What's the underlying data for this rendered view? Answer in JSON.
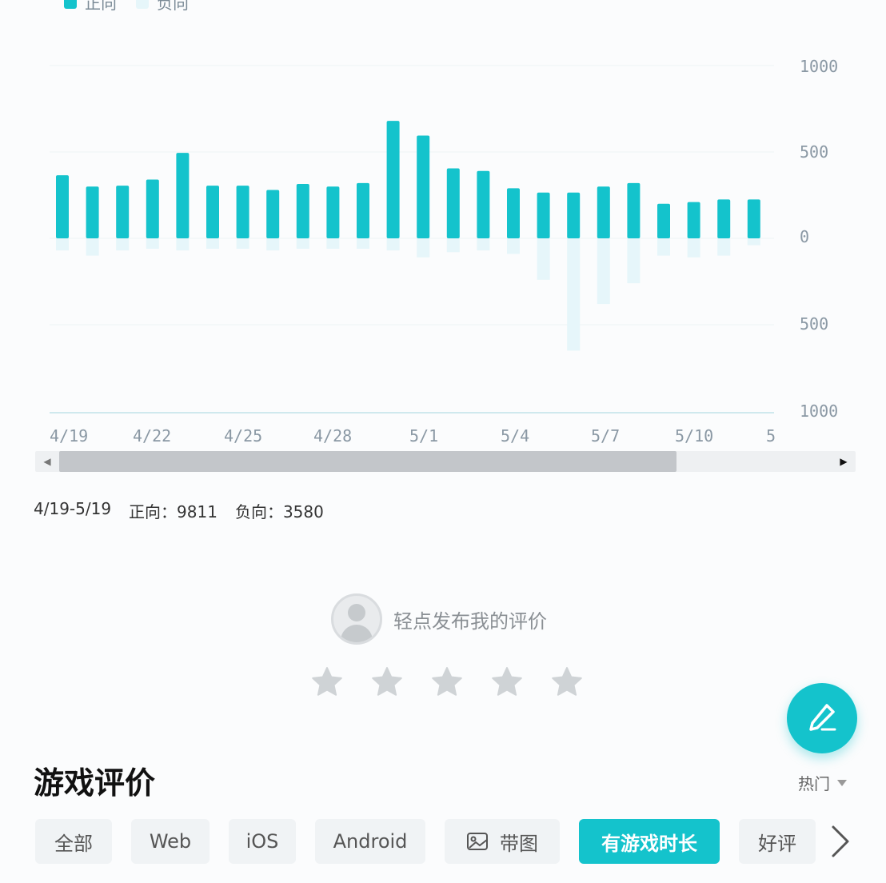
{
  "legend": {
    "positive_label": "正向",
    "negative_label": "负向",
    "positive_color": "#14c3cc",
    "negative_color": "#e6f6fa"
  },
  "chart_data": {
    "type": "bar",
    "x_tick_labels": [
      "4/19",
      "4/22",
      "4/25",
      "4/28",
      "5/1",
      "5/4",
      "5/7",
      "5/10",
      "5"
    ],
    "y_tick_labels": [
      "1000",
      "500",
      "0",
      "500",
      "1000"
    ],
    "ylim": [
      -1000,
      1000
    ],
    "categories": [
      "4/19",
      "4/20",
      "4/21",
      "4/22",
      "4/23",
      "4/24",
      "4/25",
      "4/26",
      "4/27",
      "4/28",
      "4/29",
      "4/30",
      "5/1",
      "5/2",
      "5/3",
      "5/4",
      "5/5",
      "5/6",
      "5/7",
      "5/8",
      "5/9",
      "5/10",
      "5/11",
      "5/12"
    ],
    "series": [
      {
        "name": "正向",
        "values": [
          365,
          300,
          305,
          340,
          495,
          305,
          305,
          280,
          315,
          300,
          320,
          680,
          595,
          405,
          390,
          290,
          265,
          265,
          300,
          320,
          200,
          210,
          225,
          225
        ]
      },
      {
        "name": "负向",
        "values": [
          -70,
          -100,
          -70,
          -60,
          -70,
          -60,
          -60,
          -70,
          -60,
          -60,
          -60,
          -70,
          -110,
          -80,
          -70,
          -90,
          -240,
          -650,
          -380,
          -260,
          -100,
          -110,
          -100,
          -40
        ]
      }
    ],
    "grid": true
  },
  "summary": {
    "range": "4/19-5/19",
    "positive": "正向：9811",
    "negative": "负向：3580"
  },
  "review_prompt": "轻点发布我的评价",
  "star_count": 5,
  "section_title": "游戏评价",
  "sort_label": "热门",
  "filters": [
    {
      "label": "全部"
    },
    {
      "label": "Web"
    },
    {
      "label": "iOS"
    },
    {
      "label": "Android"
    },
    {
      "label": "带图"
    },
    {
      "label": "有游戏时长"
    },
    {
      "label": "好评"
    }
  ],
  "accent_color": "#14c3cc"
}
